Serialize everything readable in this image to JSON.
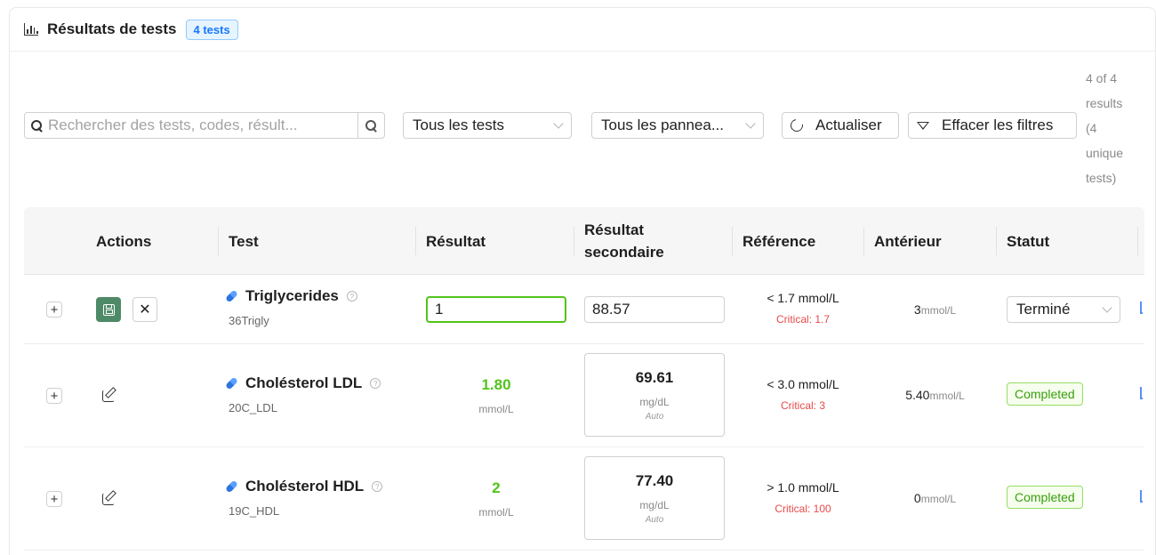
{
  "header": {
    "title": "Résultats de tests",
    "count_badge": "4 tests"
  },
  "toolbar": {
    "search_placeholder": "Rechercher des tests, codes, résult...",
    "filter_tests": "Tous les tests",
    "filter_panels": "Tous les pannea...",
    "refresh_label": "Actualiser",
    "clear_label": "Effacer les filtres",
    "results_info_lines": [
      "4 of 4",
      "results",
      "(4",
      "unique",
      "tests)"
    ]
  },
  "columns": {
    "actions": "Actions",
    "test": "Test",
    "result": "Résultat",
    "secondary_l1": "Résultat",
    "secondary_l2": "secondaire",
    "reference": "Référence",
    "previous": "Antérieur",
    "status": "Statut"
  },
  "rows": [
    {
      "name": "Triglycerides",
      "code": "36Trigly",
      "result_input": "1",
      "secondary_input": "88.57",
      "ref": "< 1.7 mmol/L",
      "critical": "Critical: 1.7",
      "prev_value": "3",
      "prev_unit": "mmol/L",
      "status": "Terminé"
    },
    {
      "name": "Cholésterol LDL",
      "code": "20C_LDL",
      "result_value": "1.80",
      "result_unit": "mmol/L",
      "secondary_value": "69.61",
      "secondary_unit": "mg/dL",
      "secondary_note": "Auto",
      "ref": "< 3.0 mmol/L",
      "critical": "Critical: 3",
      "prev_value": "5.40",
      "prev_unit": "mmol/L",
      "status": "Completed"
    },
    {
      "name": "Cholésterol HDL",
      "code": "19C_HDL",
      "result_value": "2",
      "result_unit": "mmol/L",
      "secondary_value": "77.40",
      "secondary_unit": "mg/dL",
      "secondary_note": "Auto",
      "ref": "> 1.0 mmol/L",
      "critical": "Critical: 100",
      "prev_value": "0",
      "prev_unit": "mmol/L",
      "status": "Completed"
    }
  ],
  "colors": {
    "accent_blue": "#1677ff",
    "save_green": "#4f8a68",
    "result_green": "#52c41a",
    "critical_red": "#e84a4a",
    "tag_green": "#389e0d"
  },
  "icons": {
    "header": "bar-chart-icon",
    "search": "search-icon",
    "refresh": "refresh-icon",
    "clear": "funnel-icon",
    "save": "save-icon",
    "cancel": "close-icon",
    "edit": "edit-icon",
    "test": "pill-icon",
    "help": "help-icon"
  }
}
